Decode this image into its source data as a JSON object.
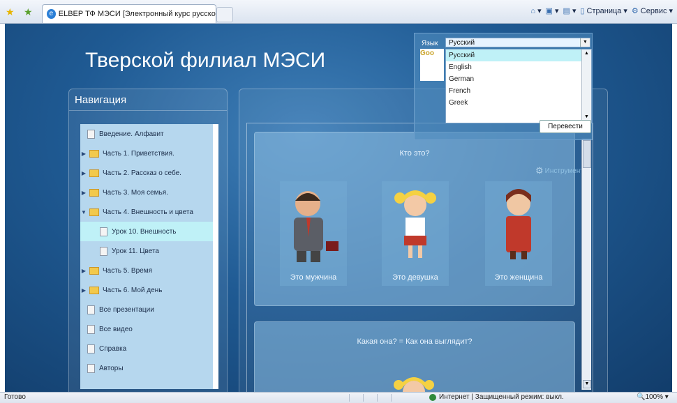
{
  "browser": {
    "tab_title": "ELBEP ТФ МЭСИ [Электронный курс русского ...",
    "commands": [
      "Страница",
      "Сервис"
    ]
  },
  "site": {
    "title": "Тверской филиал МЭСИ",
    "nav_header": "Навигация",
    "nav_items": [
      {
        "label": "Введение. Алфавит",
        "type": "doc"
      },
      {
        "label": "Часть 1. Приветствия.",
        "type": "folder"
      },
      {
        "label": "Часть 2. Рассказ о себе.",
        "type": "folder"
      },
      {
        "label": "Часть 3. Моя семья.",
        "type": "folder"
      },
      {
        "label": "Часть 4. Внешность и цвета",
        "type": "folder-open"
      },
      {
        "label": "Урок 10. Внешность",
        "type": "doc",
        "active": true
      },
      {
        "label": "Урок 11. Цвета",
        "type": "doc"
      },
      {
        "label": "Часть 5. Время",
        "type": "folder"
      },
      {
        "label": "Часть 6. Мой день",
        "type": "folder"
      },
      {
        "label": "Все презентации",
        "type": "doc"
      },
      {
        "label": "Все видео",
        "type": "doc"
      },
      {
        "label": "Справка",
        "type": "doc"
      },
      {
        "label": "Авторы",
        "type": "doc"
      }
    ]
  },
  "content": {
    "tools_label": "Инструменты",
    "card1_title": "Кто это?",
    "characters": [
      "Это мужчина",
      "Это девушка",
      "Это женщина"
    ],
    "card2_title": "Какая она? = Как она выглядит?"
  },
  "translate": {
    "lang_label": "Язык",
    "selected": "Русский",
    "options": [
      "Русский",
      "English",
      "German",
      "French",
      "Greek"
    ],
    "button": "Перевести",
    "logo_text": "Goo"
  },
  "status": {
    "ready": "Готово",
    "zone": "Интернет | Защищенный режим: выкл.",
    "zoom": "100%"
  }
}
